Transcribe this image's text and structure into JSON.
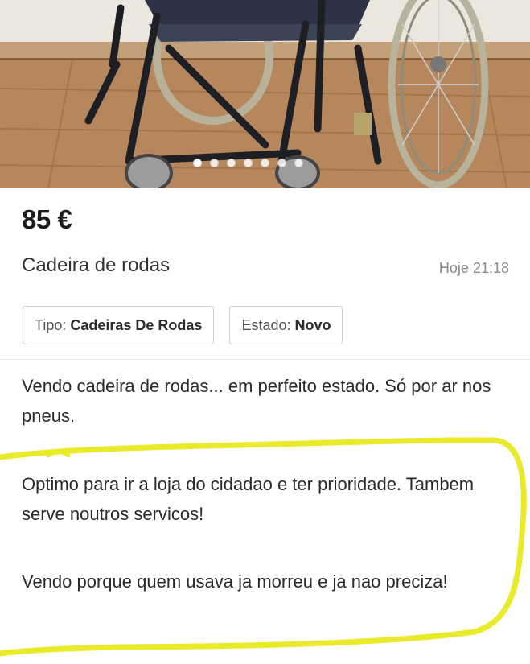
{
  "listing": {
    "price": "85 €",
    "title": "Cadeira de rodas",
    "posted_time": "Hoje 21:18",
    "attributes": [
      {
        "label": "Tipo:",
        "value": "Cadeiras De Rodas"
      },
      {
        "label": "Estado:",
        "value": "Novo"
      }
    ],
    "description": [
      "Vendo cadeira de rodas... em perfeito estado. Só por ar nos pneus.",
      "Optimo para ir a loja do cidadao e ter prioridade. Tambem serve noutros servicos!",
      "Vendo porque quem usava ja morreu e ja nao preciza!"
    ]
  },
  "gallery": {
    "image_count": 7,
    "active_index": 0,
    "subject": "wheelchair-photo"
  },
  "colors": {
    "highlight": "#e8ea2a",
    "floor": "#b98c63",
    "wall": "#ece7df"
  }
}
